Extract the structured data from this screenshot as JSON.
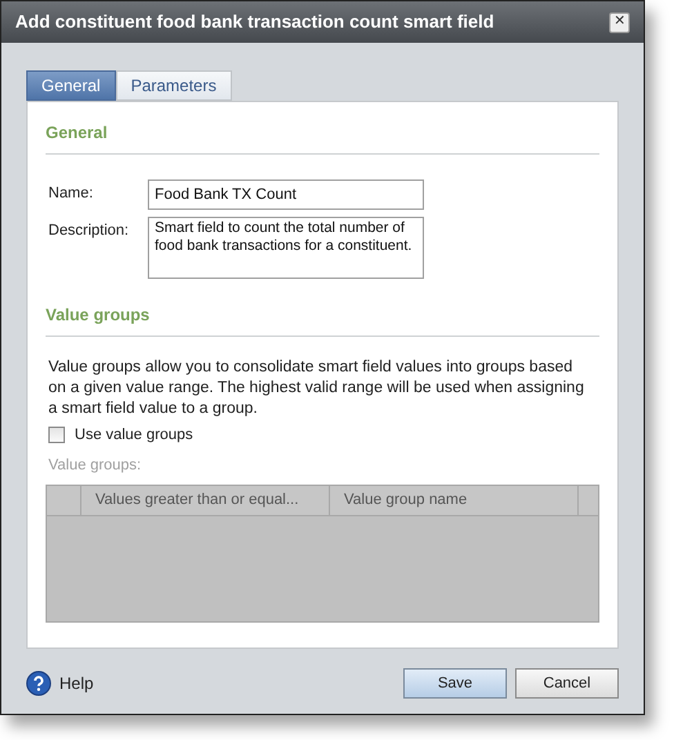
{
  "window": {
    "title": "Add constituent food bank transaction count smart field",
    "close": "✕"
  },
  "tabs": [
    {
      "label": "General",
      "selected": true
    },
    {
      "label": "Parameters",
      "selected": false
    }
  ],
  "general": {
    "heading": "General",
    "fields": [
      {
        "label": "Name:",
        "value": "Food Bank TX Count",
        "kind": "text"
      },
      {
        "label": "Description:",
        "value": "Smart field to count the total number of food bank transactions for a constituent.",
        "kind": "textarea"
      }
    ]
  },
  "value_groups": {
    "heading": "Value groups",
    "description": "Value groups allow you to consolidate smart field values into groups based on a given value range. The highest valid range will be used when assigning a smart field value to a group.",
    "checkbox": {
      "label": "Use value groups",
      "checked": false
    },
    "grid_label": "Value groups:",
    "disabled": true,
    "columns": [
      "Values greater than or equal...",
      "Value group name"
    ]
  },
  "footer": {
    "help": "Help",
    "buttons": [
      {
        "label": "Save",
        "kind": "primary"
      },
      {
        "label": "Cancel",
        "kind": "secondary"
      }
    ]
  }
}
